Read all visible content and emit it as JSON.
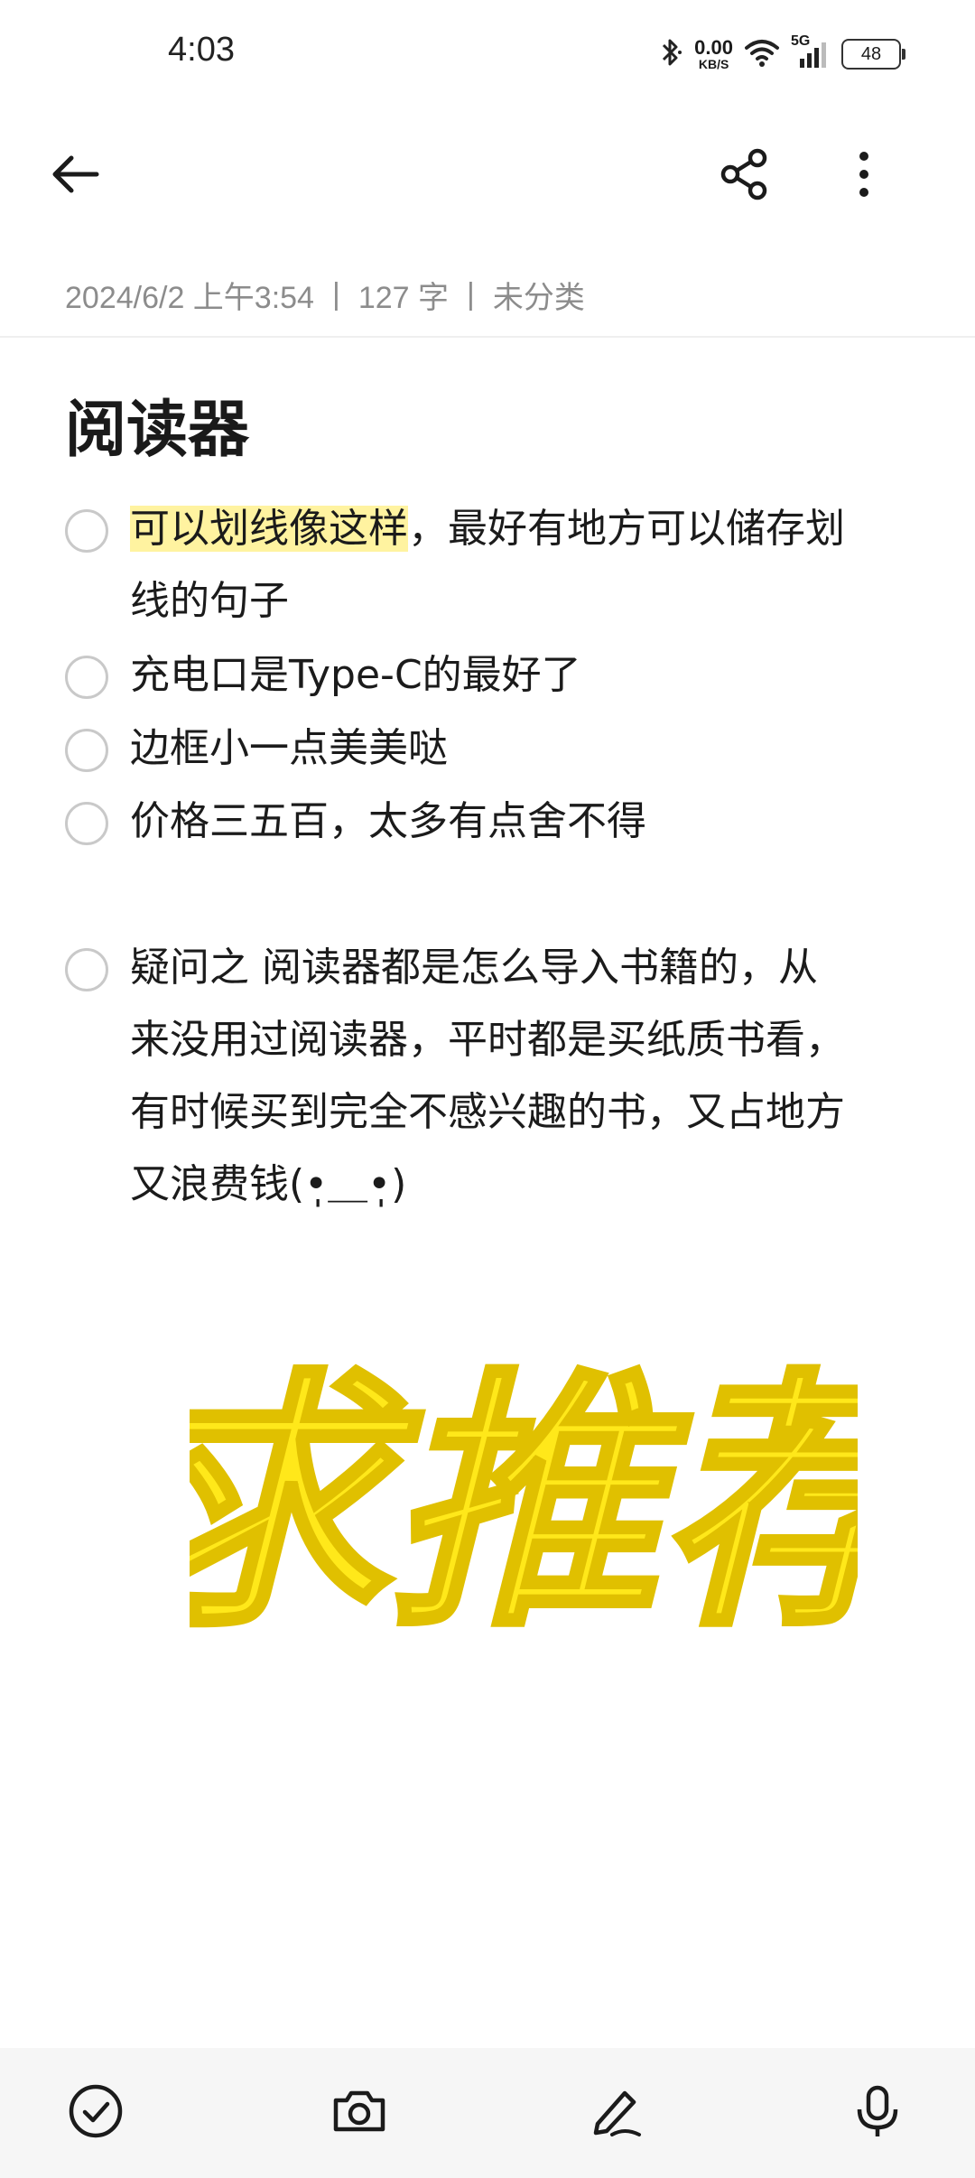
{
  "status_bar": {
    "time": "4:03",
    "net_speed": "0.00",
    "net_unit": "KB/S",
    "network_label": "5G",
    "battery": "48"
  },
  "note": {
    "date": "2024/6/2 上午3:54",
    "sep1": "|",
    "word_count": "127 字",
    "sep2": "|",
    "category": "未分类",
    "title": "阅读器",
    "items": [
      {
        "highlight": "可以划线像这样",
        "text_line1_rest": "，最好有地方可以储存划",
        "text_line2": "线的句子"
      },
      {
        "text": "充电口是Type-C的最好了"
      },
      {
        "text": "边框小一点美美哒"
      },
      {
        "text": "价格三五百，太多有点舍不得"
      },
      {
        "line1": "疑问之 阅读器都是怎么导入书籍的，从",
        "line2": "来没用过阅读器，平时都是买纸质书看，",
        "line3": "有时候买到完全不感兴趣的书，又占地方",
        "line4": "又浪费钱(•̩̩̩̩＿•̩̩̩̩)"
      }
    ],
    "sticker_text": "求推荐"
  },
  "icons": {
    "back": "back-arrow-icon",
    "share": "share-icon",
    "more": "more-vertical-icon",
    "checklist": "checklist-icon",
    "camera": "camera-icon",
    "draw": "pen-icon",
    "voice": "microphone-icon"
  },
  "colors": {
    "highlight": "#fff3a0",
    "sticker_fill": "#ffe81a",
    "sticker_stroke": "#e0c000"
  }
}
